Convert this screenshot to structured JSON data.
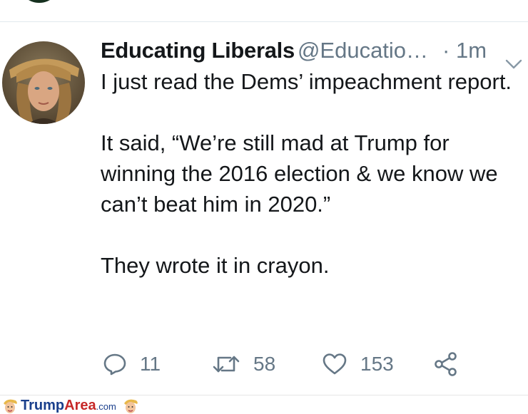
{
  "colors": {
    "text": "#14171a",
    "secondary": "#657786",
    "divider": "#e1e8ed",
    "footer_blue": "#1a3f8c",
    "footer_red": "#c62828"
  },
  "tweet": {
    "display_name": "Educating Liberals",
    "handle": "@Educatio…",
    "time_separator": "·",
    "time": "1m",
    "paragraphs": [
      "I just read the Dems’ impeachment report.",
      "It said, “We’re still mad at Trump for winning the 2016 election & we know we can’t beat him in 2020.”",
      "They wrote it in crayon."
    ]
  },
  "actions": {
    "reply": {
      "icon": "reply-icon",
      "count": "11"
    },
    "retweet": {
      "icon": "retweet-icon",
      "count": "58"
    },
    "like": {
      "icon": "heart-icon",
      "count": "153"
    },
    "share": {
      "icon": "share-icon"
    }
  },
  "footer": {
    "brand_part1": "Trump",
    "brand_part2": "Area",
    "brand_part3": ".com"
  }
}
